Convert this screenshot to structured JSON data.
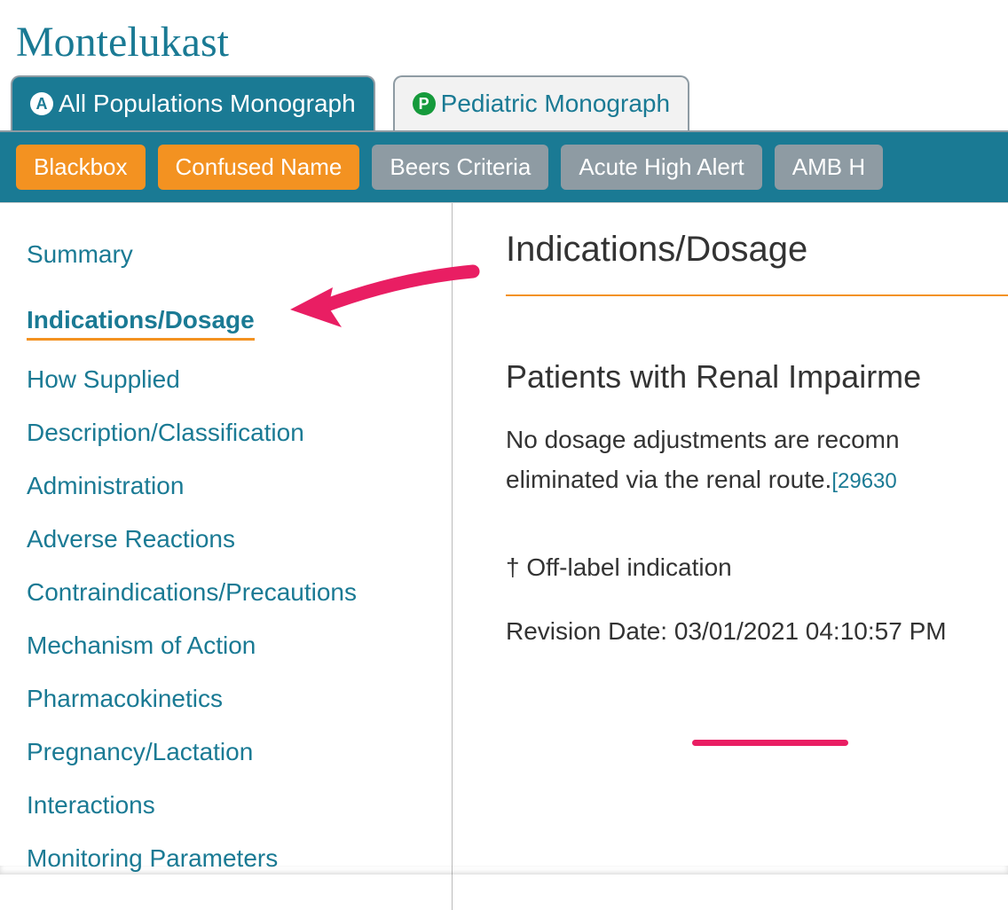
{
  "title": "Montelukast",
  "tabs": [
    {
      "badge": "A",
      "label": "All Populations Monograph",
      "active": true
    },
    {
      "badge": "P",
      "label": "Pediatric Monograph",
      "active": false
    }
  ],
  "alerts": [
    {
      "label": "Blackbox",
      "style": "orange"
    },
    {
      "label": "Confused Name",
      "style": "orange"
    },
    {
      "label": "Beers Criteria",
      "style": "gray"
    },
    {
      "label": "Acute High Alert",
      "style": "gray"
    },
    {
      "label": "AMB H",
      "style": "gray"
    }
  ],
  "sidebar": {
    "items": [
      {
        "label": "Summary",
        "active": false
      },
      {
        "label": "Indications/Dosage",
        "active": true
      },
      {
        "label": "How Supplied",
        "active": false
      },
      {
        "label": "Description/Classification",
        "active": false
      },
      {
        "label": "Administration",
        "active": false
      },
      {
        "label": "Adverse Reactions",
        "active": false
      },
      {
        "label": "Contraindications/Precautions",
        "active": false
      },
      {
        "label": "Mechanism of Action",
        "active": false
      },
      {
        "label": "Pharmacokinetics",
        "active": false
      },
      {
        "label": "Pregnancy/Lactation",
        "active": false
      },
      {
        "label": "Interactions",
        "active": false
      },
      {
        "label": "Monitoring Parameters",
        "active": false
      }
    ]
  },
  "main": {
    "heading": "Indications/Dosage",
    "subheading": "Patients with Renal Impairme",
    "body_line1": "No dosage adjustments are recomn",
    "body_line2": "eliminated via the renal route.",
    "reference": "[29630",
    "footnote": "† Off-label indication",
    "revision_label": "Revision Date: ",
    "revision_value": "03/01/2021 04:10:57 PM"
  }
}
